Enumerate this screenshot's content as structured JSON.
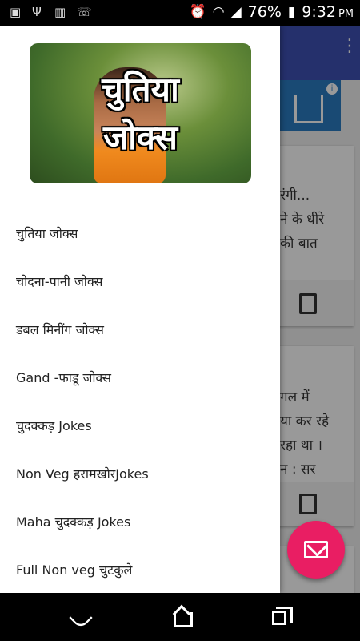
{
  "status_bar": {
    "battery": "76%",
    "time": "9:32",
    "ampm": "PM",
    "icons": [
      "image-icon",
      "usb-icon",
      "barcode-icon",
      "missed-call-icon",
      "alarm-icon",
      "wifi-icon",
      "signal-icon",
      "battery-icon"
    ]
  },
  "drawer": {
    "header_title_line1": "चुतिया",
    "header_title_line2": "जोक्स",
    "items": [
      "चुतिया जोक्स",
      "चोदना-पानी जोक्स",
      "डबल मिनींग जोक्स",
      "Gand -फाडू जोक्स",
      "चुदक्कड़ Jokes",
      "Non Veg हरामखोरJokes",
      "Maha चुदक्कड़ Jokes",
      "Full Non veg चुटकुले"
    ]
  },
  "background": {
    "card1_lines": [
      "रंगी...",
      "ने के धीरे",
      "की बात"
    ],
    "card2_lines": [
      "गल में",
      "या कर रहे",
      "रहा था ।",
      "न : सर"
    ],
    "ad_info": "i"
  },
  "colors": {
    "toolbar": "#3f51b5",
    "fab": "#e91e63",
    "ad": "#2a7cc2"
  }
}
